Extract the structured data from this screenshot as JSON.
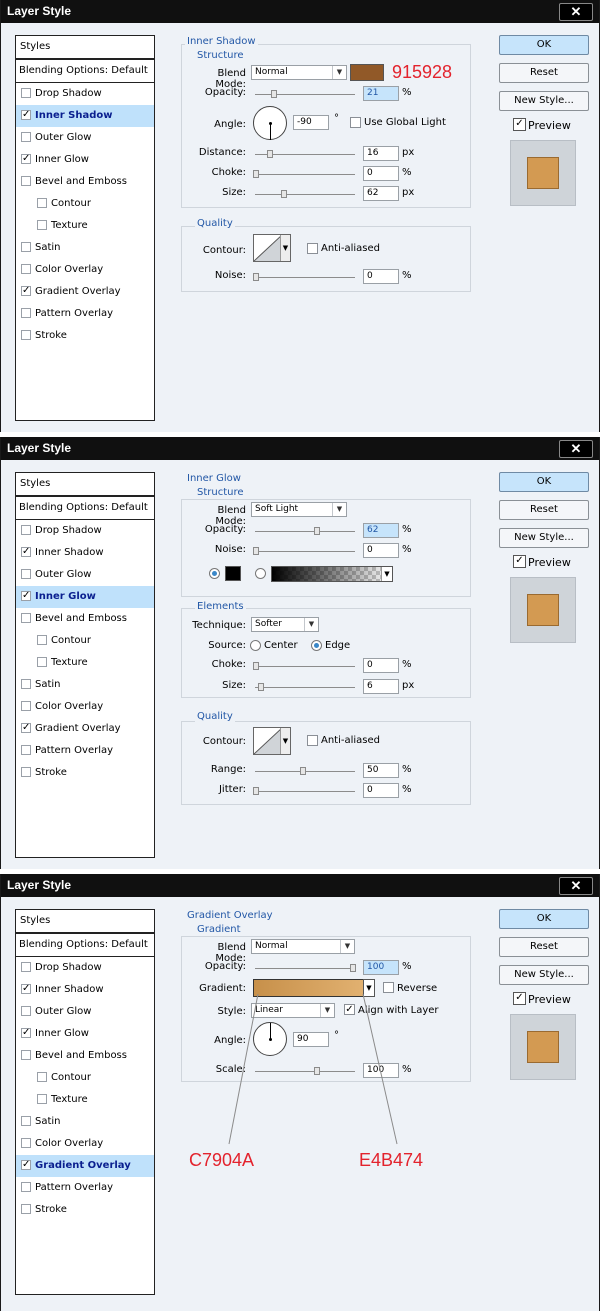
{
  "dialog_title": "Layer Style",
  "buttons": {
    "ok": "OK",
    "reset": "Reset",
    "new_style": "New Style...",
    "preview": "Preview"
  },
  "styles_header": "Styles",
  "blending_options": "Blending Options: Default",
  "style_list": [
    "Drop Shadow",
    "Inner Shadow",
    "Outer Glow",
    "Inner Glow",
    "Bevel and Emboss",
    "Contour",
    "Texture",
    "Satin",
    "Color Overlay",
    "Gradient Overlay",
    "Pattern Overlay",
    "Stroke"
  ],
  "colors": {
    "shadow": "#915928",
    "gradient_start": "#C7904A",
    "gradient_end": "#E4B474",
    "annotation": "#e3232d"
  },
  "panels": [
    {
      "selected": "Inner Shadow",
      "checked": [
        "Inner Shadow",
        "Inner Glow",
        "Gradient Overlay"
      ],
      "section": "Inner Shadow",
      "structure": "Structure",
      "quality": "Quality",
      "blend_mode_label": "Blend Mode:",
      "blend_mode": "Normal",
      "hex_annotation": "915928",
      "opacity_label": "Opacity:",
      "opacity": "21",
      "angle_label": "Angle:",
      "angle": "-90",
      "use_global_light": "Use Global Light",
      "distance_label": "Distance:",
      "distance": "16",
      "choke_label": "Choke:",
      "choke": "0",
      "size_label": "Size:",
      "size": "62",
      "contour_label": "Contour:",
      "anti_aliased": "Anti-aliased",
      "noise_label": "Noise:",
      "noise": "0"
    },
    {
      "selected": "Inner Glow",
      "checked": [
        "Inner Shadow",
        "Inner Glow",
        "Gradient Overlay"
      ],
      "section": "Inner Glow",
      "structure": "Structure",
      "elements": "Elements",
      "quality": "Quality",
      "blend_mode_label": "Blend Mode:",
      "blend_mode": "Soft Light",
      "opacity_label": "Opacity:",
      "opacity": "62",
      "noise_label": "Noise:",
      "noise": "0",
      "technique_label": "Technique:",
      "technique": "Softer",
      "source_label": "Source:",
      "center": "Center",
      "edge": "Edge",
      "choke_label": "Choke:",
      "choke": "0",
      "size_label": "Size:",
      "size": "6",
      "contour_label": "Contour:",
      "anti_aliased": "Anti-aliased",
      "range_label": "Range:",
      "range": "50",
      "jitter_label": "Jitter:",
      "jitter": "0"
    },
    {
      "selected": "Gradient Overlay",
      "checked": [
        "Inner Shadow",
        "Inner Glow",
        "Gradient Overlay"
      ],
      "section": "Gradient Overlay",
      "structure": "Gradient",
      "blend_mode_label": "Blend Mode:",
      "blend_mode": "Normal",
      "opacity_label": "Opacity:",
      "opacity": "100",
      "gradient_label": "Gradient:",
      "reverse": "Reverse",
      "style_label": "Style:",
      "style": "Linear",
      "align_with_layer": "Align with Layer",
      "angle_label": "Angle:",
      "angle": "90",
      "scale_label": "Scale:",
      "scale": "100",
      "annot_left": "C7904A",
      "annot_right": "E4B474"
    }
  ],
  "units": {
    "percent": "%",
    "px": "px",
    "degree": "°"
  }
}
